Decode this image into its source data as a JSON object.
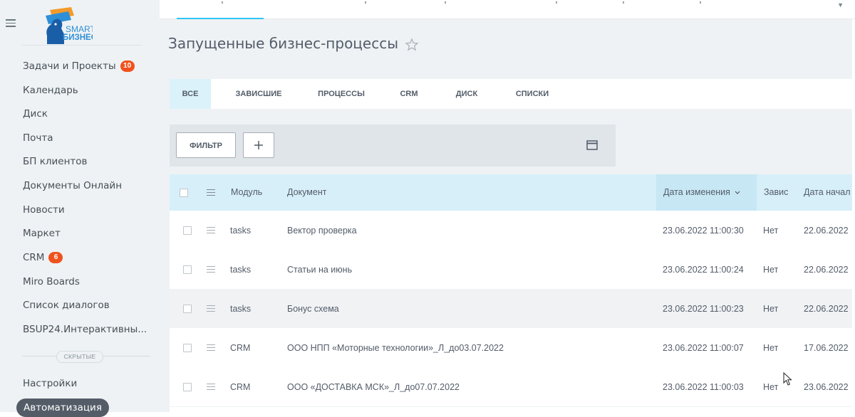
{
  "sidebar": {
    "logo_text_top": "SMART",
    "logo_text_bottom": "БИЗНЕС",
    "items": [
      {
        "label": "Задачи и Проекты",
        "counter": "10"
      },
      {
        "label": "Календарь"
      },
      {
        "label": "Диск"
      },
      {
        "label": "Почта"
      },
      {
        "label": "БП клиентов"
      },
      {
        "label": "Документы Онлайн"
      },
      {
        "label": "Новости"
      },
      {
        "label": "Маркет"
      },
      {
        "label": "CRM",
        "counter": "6"
      },
      {
        "label": "Miro Boards"
      },
      {
        "label": "Список диалогов"
      },
      {
        "label": "BSUP24.Интерактивны..."
      }
    ],
    "hidden_label": "СКРЫТЫЕ",
    "settings_label": "Настройки",
    "active_label": "Автоматизация"
  },
  "page": {
    "title": "Запущенные бизнес-процессы"
  },
  "tabs": [
    {
      "label": "ВСЕ",
      "active": true
    },
    {
      "label": "ЗАВИСШИЕ"
    },
    {
      "label": "ПРОЦЕССЫ"
    },
    {
      "label": "CRM"
    },
    {
      "label": "ДИСК"
    },
    {
      "label": "СПИСКИ"
    }
  ],
  "toolbar": {
    "filter_label": "ФИЛЬТР",
    "add_icon": "plus-icon",
    "settings_icon": "window-icon"
  },
  "grid": {
    "columns": {
      "module": "Модуль",
      "document": "Документ",
      "modified": "Дата изменения",
      "stuck": "Завис",
      "started": "Дата начал"
    },
    "rows": [
      {
        "module": "tasks",
        "document": "Вектор проверка",
        "modified": "23.06.2022 11:00:30",
        "stuck": "Нет",
        "started": "22.06.2022"
      },
      {
        "module": "tasks",
        "document": "Статьи на июнь",
        "modified": "23.06.2022 11:00:24",
        "stuck": "Нет",
        "started": "22.06.2022"
      },
      {
        "module": "tasks",
        "document": "Бонус схема",
        "modified": "23.06.2022 11:00:23",
        "stuck": "Нет",
        "started": "22.06.2022"
      },
      {
        "module": "CRM",
        "document": "ООО НПП «Моторные технологии»_Л_до03.07.2022",
        "modified": "23.06.2022 11:00:07",
        "stuck": "Нет",
        "started": "17.06.2022"
      },
      {
        "module": "CRM",
        "document": "ООО «ДОСТАВКА МСК»_Л_до07.07.2022",
        "modified": "23.06.2022 11:00:03",
        "stuck": "Нет",
        "started": "23.06.2022"
      }
    ]
  },
  "colors": {
    "accent": "#2fc6f6",
    "counter": "#f0521e",
    "header_bg": "#d7eff8",
    "sorted_col_bg": "#c7e7f4",
    "active_tab_bg": "#dbf2fb",
    "active_menu_bg": "#535c67"
  }
}
